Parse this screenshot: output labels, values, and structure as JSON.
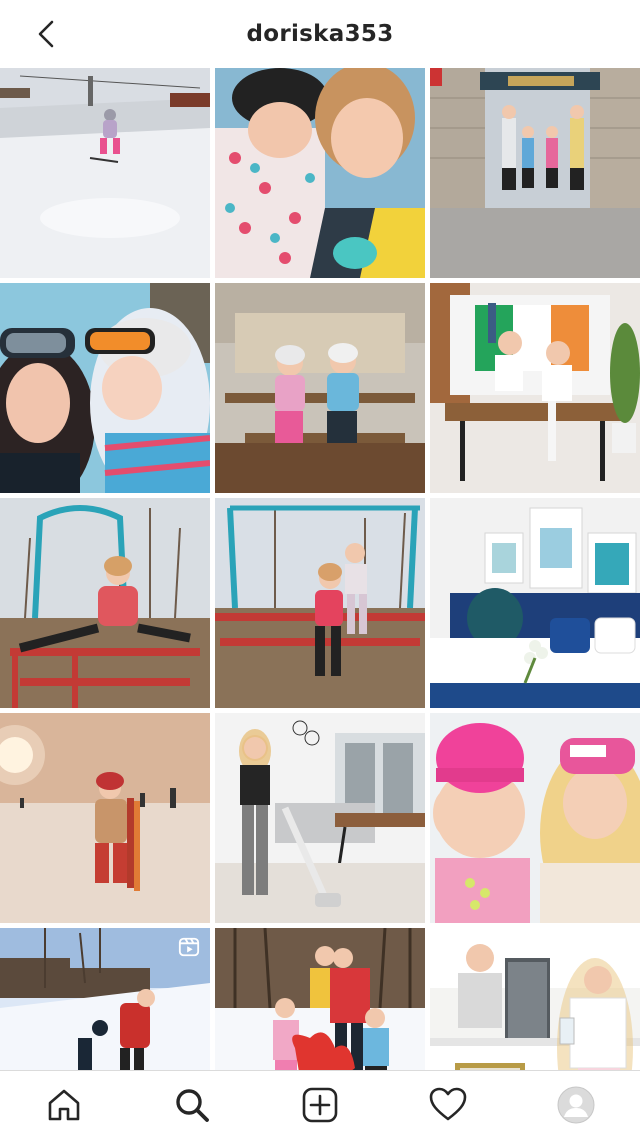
{
  "header": {
    "username": "doriska353",
    "back_icon": "chevron-left-icon"
  },
  "grid": {
    "tiles": [
      {
        "name": "ski-slope-kid",
        "badge": null
      },
      {
        "name": "selfie-mom-daughter-helmet",
        "badge": null
      },
      {
        "name": "family-entrance-gate",
        "badge": null
      },
      {
        "name": "ski-selfie-goggles",
        "badge": null
      },
      {
        "name": "kids-on-bench",
        "badge": null
      },
      {
        "name": "girls-tv-flag-table",
        "badge": null
      },
      {
        "name": "playground-swing-girl",
        "badge": null
      },
      {
        "name": "playground-girls-climb",
        "badge": null
      },
      {
        "name": "bedroom-towel-flowers",
        "badge": null
      },
      {
        "name": "night-ski-kid",
        "badge": null
      },
      {
        "name": "woman-vacuum-living-room",
        "badge": null
      },
      {
        "name": "pink-hats-mom-daughter",
        "badge": null
      },
      {
        "name": "snow-sledding-play",
        "badge": "reels-icon"
      },
      {
        "name": "family-love-balloon",
        "badge": null
      },
      {
        "name": "kitchen-couple-baking",
        "badge": "carousel-icon"
      }
    ]
  },
  "bottom_nav": {
    "items": [
      {
        "name": "home-icon"
      },
      {
        "name": "search-icon",
        "active": true
      },
      {
        "name": "new-post-icon"
      },
      {
        "name": "activity-heart-icon"
      },
      {
        "name": "profile-avatar-icon"
      }
    ]
  }
}
